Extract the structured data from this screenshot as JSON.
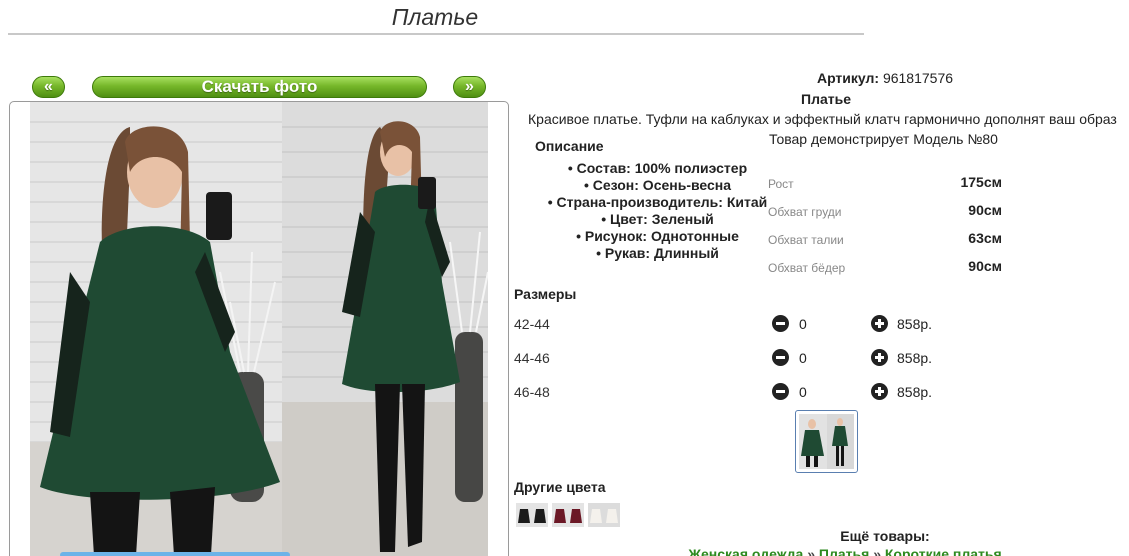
{
  "page": {
    "title": "Платье"
  },
  "gallery": {
    "prev_label": "«",
    "download_label": "Скачать фото",
    "next_label": "»"
  },
  "product": {
    "sku_label": "Артикул:",
    "sku_value": "961817576",
    "name": "Платье",
    "description": "Красивое платье. Туфли на каблуках и эффектный клатч гармонично дополнят ваш образ",
    "model_note": "Товар демонстрирует Модель №80"
  },
  "description": {
    "heading": "Описание",
    "attributes": [
      "Состав: 100% полиэстер",
      "Сезон: Осень-весна",
      "Страна-производитель: Китай",
      "Цвет: Зеленый",
      "Рисунок: Однотонные",
      "Рукав: Длинный"
    ]
  },
  "measurements": [
    {
      "label": "Рост",
      "value": "175см"
    },
    {
      "label": "Обхват груди",
      "value": "90см"
    },
    {
      "label": "Обхват талии",
      "value": "63см"
    },
    {
      "label": "Обхват бёдер",
      "value": "90см"
    }
  ],
  "sizes": {
    "heading": "Размеры",
    "rows": [
      {
        "name": "42-44",
        "qty": "0",
        "price": "858р."
      },
      {
        "name": "44-46",
        "qty": "0",
        "price": "858р."
      },
      {
        "name": "46-48",
        "qty": "0",
        "price": "858р."
      }
    ]
  },
  "other_colors": {
    "heading": "Другие цвета"
  },
  "more": {
    "heading": "Ещё товары:",
    "breadcrumb": [
      "Женская одежда",
      "Платья",
      "Короткие платья"
    ],
    "separator": "»"
  },
  "colors": {
    "button_green": "#6aab22",
    "dress_green": "#1f4a33",
    "link_green": "#2d8a1f"
  }
}
